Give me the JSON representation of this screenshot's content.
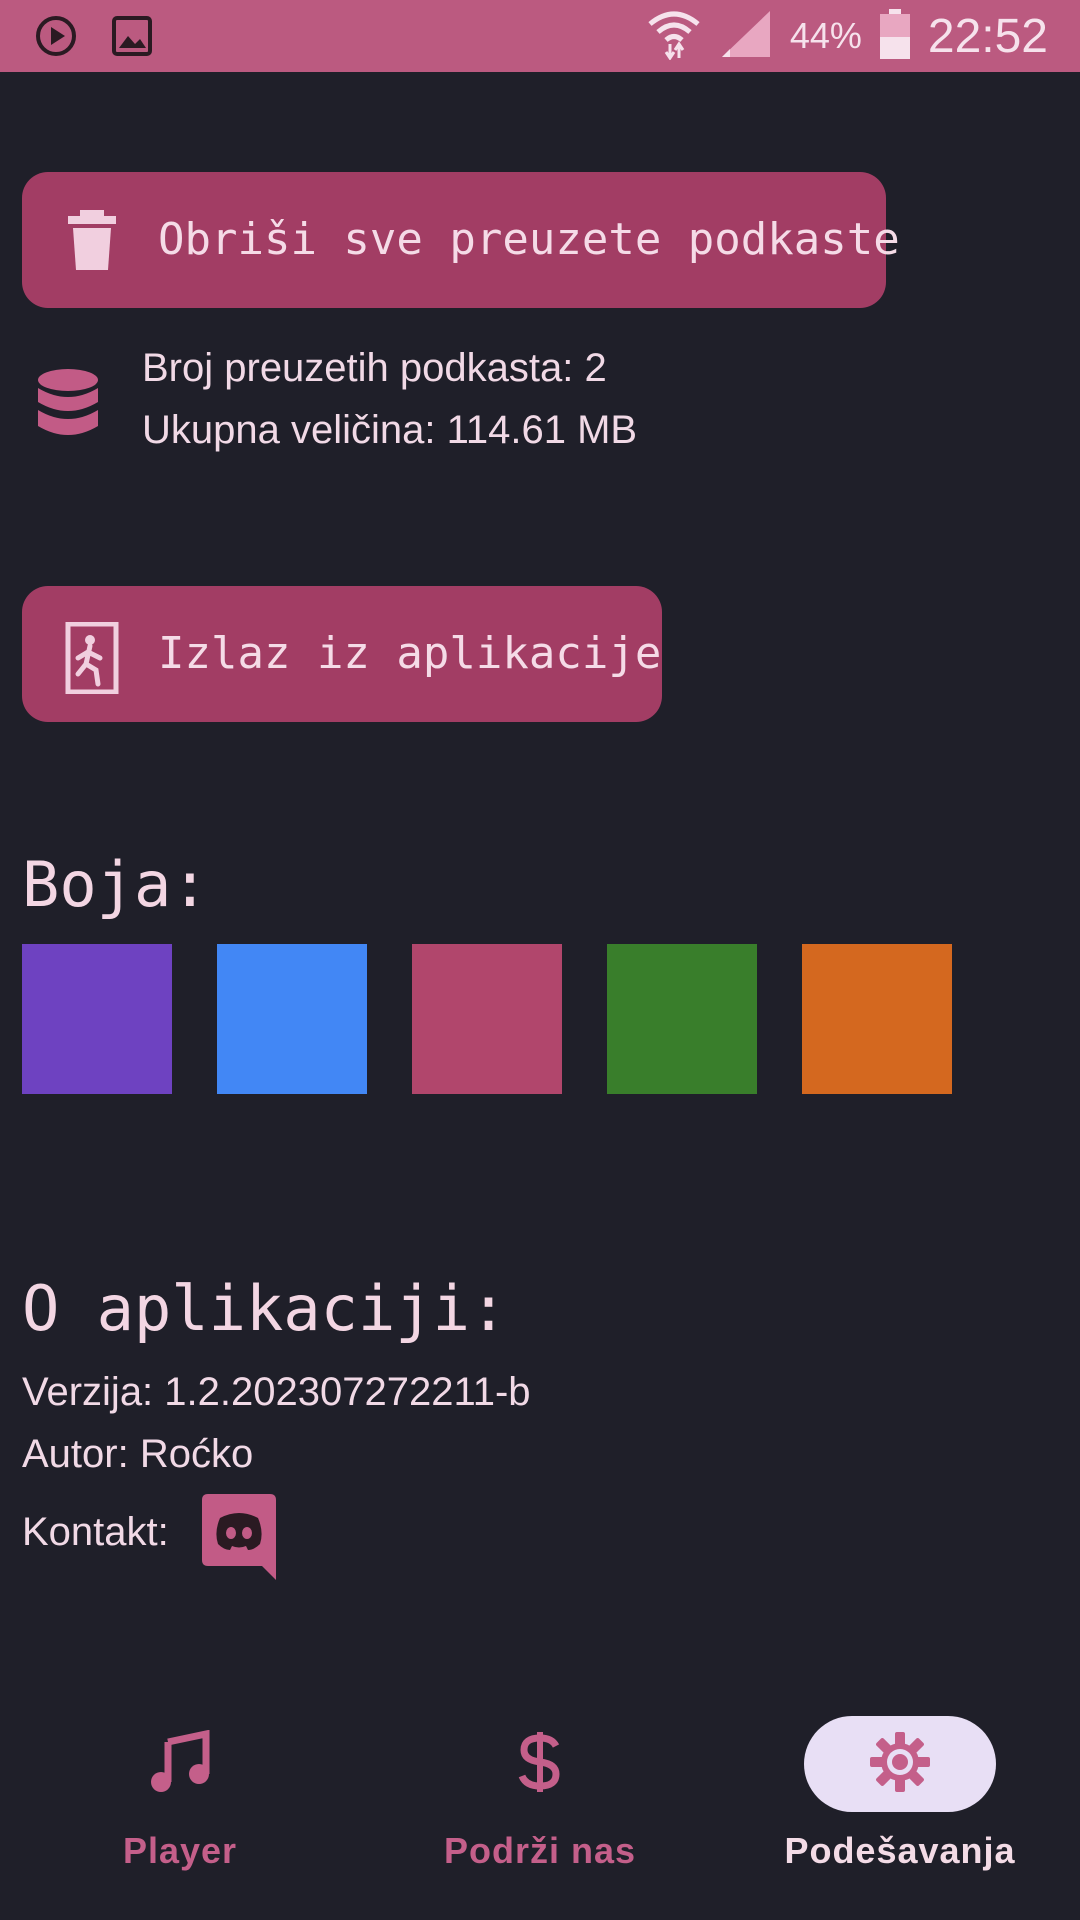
{
  "status_bar": {
    "battery_percent": "44%",
    "time": "22:52",
    "icons": [
      "play-circle-icon",
      "image-icon",
      "wifi-icon",
      "signal-icon",
      "battery-icon"
    ]
  },
  "storage": {
    "delete_button_label": "Obriši sve preuzete podkaste",
    "downloaded_count_text": "Broj preuzetih podkasta: 2",
    "total_size_text": "Ukupna veličina: 114.61 MB"
  },
  "exit_button_label": "Izlaz iz aplikacije",
  "color_section": {
    "heading": "Boja:",
    "swatches": [
      "#6e42c1",
      "#4287f5",
      "#b1466c",
      "#397e2b",
      "#d4681f"
    ]
  },
  "about": {
    "heading": "O aplikaciji:",
    "version_text": "Verzija: 1.2.202307272211-b",
    "author_text": "Autor: Roćko",
    "contact_label": "Kontakt:"
  },
  "bottom_nav": {
    "items": [
      {
        "label": "Player",
        "icon": "music-note-icon",
        "active": false
      },
      {
        "label": "Podrži nas",
        "icon": "dollar-icon",
        "active": false
      },
      {
        "label": "Podešavanja",
        "icon": "gear-icon",
        "active": true
      }
    ]
  },
  "colors": {
    "background": "#1f1f29",
    "status_bar": "#bb5a80",
    "button": "#a23d64",
    "accent": "#c45f8a",
    "text": "#f1d9e6",
    "active_pill": "#e8dff5"
  }
}
